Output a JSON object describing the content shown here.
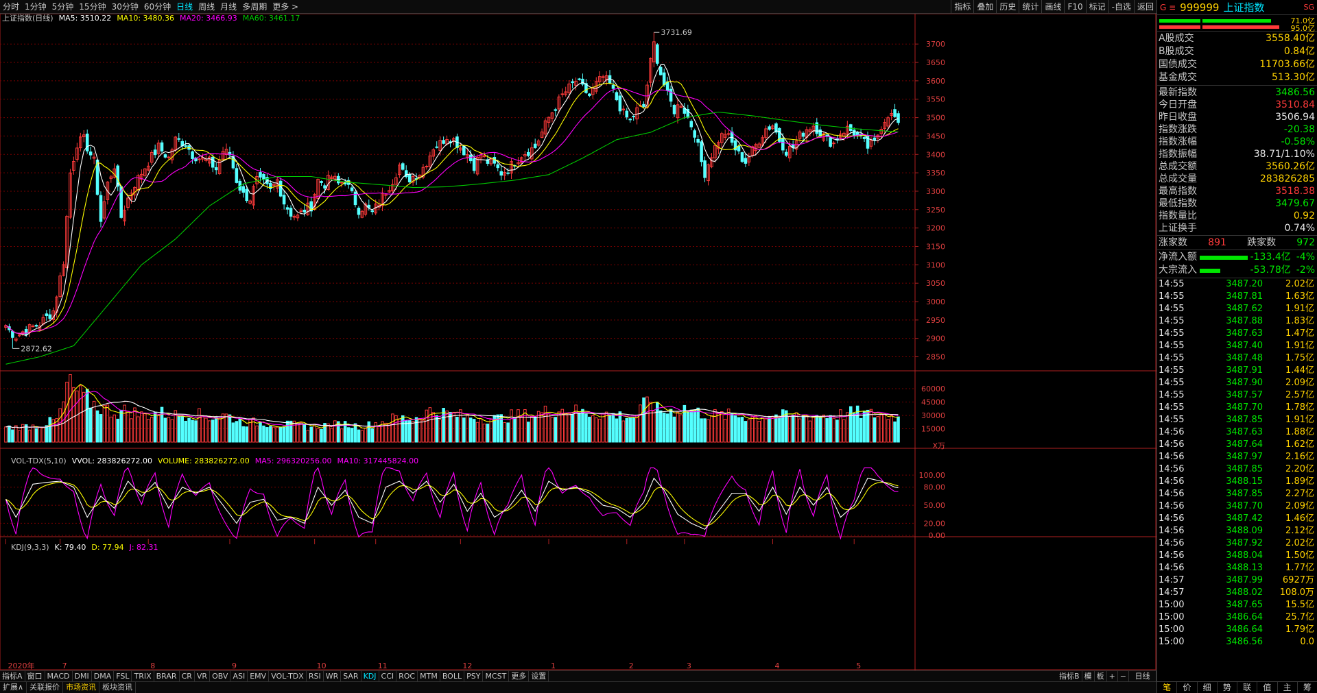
{
  "topbar": {
    "periods": [
      "分时",
      "1分钟",
      "5分钟",
      "15分钟",
      "30分钟",
      "60分钟",
      "日线",
      "周线",
      "月线",
      "多周期",
      "更多 >"
    ],
    "active_period": "日线",
    "tools": [
      "指标",
      "叠加",
      "历史",
      "统计",
      "画线",
      "F10",
      "标记",
      "-自选",
      "返回"
    ]
  },
  "legend_main": {
    "name": "上证指数(日线)",
    "ma5": "MA5: 3510.22",
    "ma10": "MA10: 3480.36",
    "ma20": "MA20: 3466.93",
    "ma60": "MA60: 3461.17"
  },
  "legend_vol": {
    "name": "VOL-TDX(5,10)",
    "vvol": "VVOL: 283826272.00",
    "volume": "VOLUME: 283826272.00",
    "ma5": "MA5: 296320256.00",
    "ma10": "MA10: 317445824.00"
  },
  "legend_kdj": {
    "name": "KDJ(9,3,3)",
    "k": "K: 79.40",
    "d": "D: 77.94",
    "j": "J: 82.31"
  },
  "colors": {
    "up": "#ff3a3a",
    "down": "#54ffff",
    "ma5": "#ffffff",
    "ma10": "#ffff00",
    "ma20": "#ff00ff",
    "ma60": "#00c800",
    "grid": "#7a0000",
    "axis": "#b02020"
  },
  "chart_data": {
    "type": "candlestick",
    "price_ticks": [
      "3700",
      "3650",
      "3600",
      "3550",
      "3500",
      "3450",
      "3400",
      "3350",
      "3300",
      "3250",
      "3200",
      "3150",
      "3100",
      "3050",
      "3000",
      "2950",
      "2900",
      "2850"
    ],
    "price_range": [
      2810,
      3760
    ],
    "vol_ticks": [
      "60000",
      "45000",
      "30000",
      "15000"
    ],
    "vol_unit": "X万",
    "vol_range": [
      0,
      70000
    ],
    "kdj_ticks": [
      "100.00",
      "80.00",
      "50.00",
      "20.00",
      "0.00"
    ],
    "kdj_range": [
      -8,
      115
    ],
    "x_labels": [
      "2020年",
      "7",
      "8",
      "9",
      "10",
      "11",
      "12",
      "1",
      "2",
      "3",
      "4",
      "5"
    ],
    "x_label_index": [
      0,
      16,
      42,
      66,
      91,
      109,
      134,
      160,
      183,
      200,
      226,
      250
    ],
    "max_label": "3731.69",
    "max_index": 191,
    "min_label": "2872.62",
    "min_index": 2,
    "key_closes": [
      [
        0,
        2930
      ],
      [
        3,
        2905
      ],
      [
        5,
        2918
      ],
      [
        10,
        2940
      ],
      [
        14,
        2975
      ],
      [
        17,
        3110
      ],
      [
        19,
        3350
      ],
      [
        21,
        3430
      ],
      [
        23,
        3440
      ],
      [
        26,
        3380
      ],
      [
        28,
        3220
      ],
      [
        30,
        3320
      ],
      [
        32,
        3370
      ],
      [
        34,
        3230
      ],
      [
        36,
        3280
      ],
      [
        38,
        3320
      ],
      [
        40,
        3350
      ],
      [
        42,
        3380
      ],
      [
        45,
        3420
      ],
      [
        48,
        3390
      ],
      [
        50,
        3440
      ],
      [
        53,
        3430
      ],
      [
        55,
        3400
      ],
      [
        57,
        3390
      ],
      [
        60,
        3380
      ],
      [
        62,
        3360
      ],
      [
        64,
        3410
      ],
      [
        66,
        3400
      ],
      [
        68,
        3330
      ],
      [
        70,
        3290
      ],
      [
        72,
        3280
      ],
      [
        74,
        3330
      ],
      [
        76,
        3320
      ],
      [
        78,
        3300
      ],
      [
        80,
        3330
      ],
      [
        82,
        3270
      ],
      [
        84,
        3240
      ],
      [
        86,
        3230
      ],
      [
        88,
        3250
      ],
      [
        90,
        3260
      ],
      [
        92,
        3330
      ],
      [
        94,
        3320
      ],
      [
        96,
        3340
      ],
      [
        98,
        3320
      ],
      [
        100,
        3330
      ],
      [
        102,
        3290
      ],
      [
        104,
        3250
      ],
      [
        106,
        3260
      ],
      [
        108,
        3240
      ],
      [
        110,
        3270
      ],
      [
        112,
        3300
      ],
      [
        114,
        3330
      ],
      [
        116,
        3370
      ],
      [
        118,
        3330
      ],
      [
        120,
        3340
      ],
      [
        122,
        3350
      ],
      [
        124,
        3380
      ],
      [
        126,
        3420
      ],
      [
        128,
        3430
      ],
      [
        130,
        3450
      ],
      [
        132,
        3440
      ],
      [
        134,
        3420
      ],
      [
        136,
        3400
      ],
      [
        138,
        3370
      ],
      [
        140,
        3400
      ],
      [
        142,
        3380
      ],
      [
        144,
        3370
      ],
      [
        146,
        3350
      ],
      [
        148,
        3360
      ],
      [
        150,
        3380
      ],
      [
        152,
        3400
      ],
      [
        154,
        3410
      ],
      [
        156,
        3420
      ],
      [
        158,
        3460
      ],
      [
        160,
        3500
      ],
      [
        162,
        3530
      ],
      [
        164,
        3560
      ],
      [
        166,
        3580
      ],
      [
        168,
        3600
      ],
      [
        170,
        3580
      ],
      [
        172,
        3560
      ],
      [
        174,
        3590
      ],
      [
        176,
        3610
      ],
      [
        178,
        3590
      ],
      [
        180,
        3550
      ],
      [
        182,
        3510
      ],
      [
        184,
        3490
      ],
      [
        186,
        3520
      ],
      [
        188,
        3530
      ],
      [
        190,
        3650
      ],
      [
        191,
        3700
      ],
      [
        193,
        3620
      ],
      [
        195,
        3560
      ],
      [
        197,
        3520
      ],
      [
        199,
        3540
      ],
      [
        201,
        3500
      ],
      [
        203,
        3460
      ],
      [
        205,
        3380
      ],
      [
        206,
        3350
      ],
      [
        208,
        3400
      ],
      [
        210,
        3440
      ],
      [
        212,
        3460
      ],
      [
        214,
        3430
      ],
      [
        216,
        3400
      ],
      [
        218,
        3380
      ],
      [
        220,
        3410
      ],
      [
        222,
        3440
      ],
      [
        224,
        3470
      ],
      [
        226,
        3480
      ],
      [
        228,
        3440
      ],
      [
        230,
        3410
      ],
      [
        232,
        3420
      ],
      [
        234,
        3450
      ],
      [
        236,
        3470
      ],
      [
        238,
        3480
      ],
      [
        240,
        3460
      ],
      [
        242,
        3440
      ],
      [
        244,
        3430
      ],
      [
        246,
        3460
      ],
      [
        248,
        3470
      ],
      [
        250,
        3460
      ],
      [
        252,
        3440
      ],
      [
        254,
        3420
      ],
      [
        256,
        3430
      ],
      [
        258,
        3480
      ],
      [
        260,
        3510
      ],
      [
        262,
        3500
      ],
      [
        263,
        3486
      ]
    ],
    "vol_series": [
      [
        0,
        16000
      ],
      [
        4,
        17000
      ],
      [
        8,
        18000
      ],
      [
        12,
        21000
      ],
      [
        15,
        25000
      ],
      [
        17,
        42000
      ],
      [
        18,
        65000
      ],
      [
        20,
        60000
      ],
      [
        22,
        52000
      ],
      [
        24,
        48000
      ],
      [
        27,
        40000
      ],
      [
        30,
        36000
      ],
      [
        33,
        33000
      ],
      [
        36,
        36000
      ],
      [
        40,
        30000
      ],
      [
        45,
        33000
      ],
      [
        50,
        30000
      ],
      [
        55,
        32000
      ],
      [
        60,
        28000
      ],
      [
        65,
        30000
      ],
      [
        70,
        22000
      ],
      [
        75,
        22000
      ],
      [
        80,
        20000
      ],
      [
        85,
        19000
      ],
      [
        90,
        17000
      ],
      [
        95,
        19000
      ],
      [
        100,
        20000
      ],
      [
        105,
        17000
      ],
      [
        110,
        22000
      ],
      [
        115,
        27000
      ],
      [
        120,
        26000
      ],
      [
        125,
        35000
      ],
      [
        130,
        32000
      ],
      [
        135,
        29000
      ],
      [
        140,
        27000
      ],
      [
        145,
        26000
      ],
      [
        150,
        30000
      ],
      [
        155,
        30000
      ],
      [
        160,
        35000
      ],
      [
        165,
        37000
      ],
      [
        170,
        33000
      ],
      [
        175,
        32000
      ],
      [
        180,
        30000
      ],
      [
        185,
        28000
      ],
      [
        190,
        48000
      ],
      [
        192,
        36000
      ],
      [
        195,
        34000
      ],
      [
        200,
        38000
      ],
      [
        205,
        32000
      ],
      [
        210,
        30000
      ],
      [
        215,
        30000
      ],
      [
        220,
        28000
      ],
      [
        225,
        30000
      ],
      [
        230,
        29000
      ],
      [
        235,
        29000
      ],
      [
        240,
        30000
      ],
      [
        245,
        30000
      ],
      [
        250,
        33000
      ],
      [
        255,
        31000
      ],
      [
        260,
        30000
      ],
      [
        263,
        28000
      ]
    ],
    "kdj_k_keys": [
      [
        0,
        60
      ],
      [
        3,
        30
      ],
      [
        8,
        85
      ],
      [
        12,
        88
      ],
      [
        16,
        90
      ],
      [
        20,
        80
      ],
      [
        24,
        30
      ],
      [
        28,
        65
      ],
      [
        32,
        45
      ],
      [
        36,
        90
      ],
      [
        40,
        65
      ],
      [
        44,
        88
      ],
      [
        48,
        45
      ],
      [
        52,
        80
      ],
      [
        56,
        70
      ],
      [
        60,
        80
      ],
      [
        64,
        50
      ],
      [
        68,
        20
      ],
      [
        72,
        55
      ],
      [
        76,
        60
      ],
      [
        80,
        25
      ],
      [
        84,
        30
      ],
      [
        88,
        20
      ],
      [
        92,
        80
      ],
      [
        96,
        50
      ],
      [
        100,
        75
      ],
      [
        104,
        30
      ],
      [
        108,
        20
      ],
      [
        112,
        80
      ],
      [
        116,
        90
      ],
      [
        120,
        70
      ],
      [
        124,
        90
      ],
      [
        128,
        55
      ],
      [
        132,
        85
      ],
      [
        136,
        40
      ],
      [
        140,
        70
      ],
      [
        144,
        30
      ],
      [
        148,
        45
      ],
      [
        152,
        75
      ],
      [
        156,
        40
      ],
      [
        160,
        90
      ],
      [
        164,
        75
      ],
      [
        168,
        80
      ],
      [
        172,
        70
      ],
      [
        176,
        50
      ],
      [
        180,
        45
      ],
      [
        184,
        30
      ],
      [
        188,
        55
      ],
      [
        191,
        95
      ],
      [
        194,
        75
      ],
      [
        198,
        35
      ],
      [
        202,
        20
      ],
      [
        206,
        10
      ],
      [
        210,
        40
      ],
      [
        214,
        70
      ],
      [
        218,
        70
      ],
      [
        222,
        40
      ],
      [
        226,
        80
      ],
      [
        230,
        35
      ],
      [
        234,
        80
      ],
      [
        238,
        50
      ],
      [
        242,
        80
      ],
      [
        246,
        30
      ],
      [
        250,
        50
      ],
      [
        254,
        95
      ],
      [
        258,
        90
      ],
      [
        262,
        80
      ],
      [
        263,
        79
      ]
    ],
    "ma60_keys": [
      [
        0,
        2830
      ],
      [
        10,
        2850
      ],
      [
        20,
        2880
      ],
      [
        30,
        2990
      ],
      [
        40,
        3100
      ],
      [
        50,
        3170
      ],
      [
        60,
        3260
      ],
      [
        70,
        3320
      ],
      [
        80,
        3340
      ],
      [
        90,
        3340
      ],
      [
        100,
        3325
      ],
      [
        110,
        3318
      ],
      [
        120,
        3310
      ],
      [
        130,
        3312
      ],
      [
        140,
        3320
      ],
      [
        150,
        3330
      ],
      [
        160,
        3345
      ],
      [
        170,
        3390
      ],
      [
        180,
        3440
      ],
      [
        190,
        3460
      ],
      [
        200,
        3500
      ],
      [
        210,
        3515
      ],
      [
        220,
        3505
      ],
      [
        230,
        3492
      ],
      [
        240,
        3480
      ],
      [
        250,
        3470
      ],
      [
        263,
        3461
      ]
    ]
  },
  "right_panel": {
    "header": {
      "code": "999999",
      "name": "上证指数",
      "flag": "SG",
      "prefix": "G ≡"
    },
    "bars": {
      "top_val": "71.0亿",
      "bot_val": "95.0亿"
    },
    "turnover": [
      {
        "label": "A股成交",
        "value": "3558.40亿",
        "color": "#ffd200"
      },
      {
        "label": "B股成交",
        "value": "0.84亿",
        "color": "#ffd200"
      },
      {
        "label": "国债成交",
        "value": "11703.66亿",
        "color": "#ffd200"
      },
      {
        "label": "基金成交",
        "value": "513.30亿",
        "color": "#ffd200"
      }
    ],
    "stats": [
      {
        "label": "最新指数",
        "value": "3486.56",
        "color": "#00e600"
      },
      {
        "label": "今日开盘",
        "value": "3510.84",
        "color": "#ff3a3a"
      },
      {
        "label": "昨日收盘",
        "value": "3506.94",
        "color": "#e6e6e6"
      },
      {
        "label": "指数涨跌",
        "value": "-20.38",
        "color": "#00e600"
      },
      {
        "label": "指数涨幅",
        "value": "-0.58%",
        "color": "#00e600"
      },
      {
        "label": "指数振幅",
        "value": "38.71/1.10%",
        "color": "#e6e6e6"
      },
      {
        "label": "总成交额",
        "value": "3560.26亿",
        "color": "#ffd200"
      },
      {
        "label": "总成交量",
        "value": "283826285",
        "color": "#ffd200"
      },
      {
        "label": "最高指数",
        "value": "3518.38",
        "color": "#ff3a3a"
      },
      {
        "label": "最低指数",
        "value": "3479.67",
        "color": "#00e600"
      },
      {
        "label": "指数量比",
        "value": "0.92",
        "color": "#ffd200"
      },
      {
        "label": "上证换手",
        "value": "0.74%",
        "color": "#e6e6e6"
      }
    ],
    "breadth": {
      "up_label": "涨家数",
      "up": "891",
      "down_label": "跌家数",
      "down": "972"
    },
    "flows": [
      {
        "label": "净流入额",
        "value": "-133.4亿",
        "pct": "-4%"
      },
      {
        "label": "大宗流入",
        "value": "-53.78亿",
        "pct": "-2%"
      }
    ],
    "ticks": [
      [
        "14:55",
        "3487.20",
        "2.02亿"
      ],
      [
        "14:55",
        "3487.81",
        "1.63亿"
      ],
      [
        "14:55",
        "3487.62",
        "1.91亿"
      ],
      [
        "14:55",
        "3487.88",
        "1.83亿"
      ],
      [
        "14:55",
        "3487.63",
        "1.47亿"
      ],
      [
        "14:55",
        "3487.40",
        "1.91亿"
      ],
      [
        "14:55",
        "3487.48",
        "1.75亿"
      ],
      [
        "14:55",
        "3487.91",
        "1.44亿"
      ],
      [
        "14:55",
        "3487.90",
        "2.09亿"
      ],
      [
        "14:55",
        "3487.57",
        "2.57亿"
      ],
      [
        "14:55",
        "3487.70",
        "1.78亿"
      ],
      [
        "14:55",
        "3487.85",
        "1.91亿"
      ],
      [
        "14:56",
        "3487.63",
        "1.88亿"
      ],
      [
        "14:56",
        "3487.64",
        "1.62亿"
      ],
      [
        "14:56",
        "3487.97",
        "2.16亿"
      ],
      [
        "14:56",
        "3487.85",
        "2.20亿"
      ],
      [
        "14:56",
        "3488.15",
        "1.89亿"
      ],
      [
        "14:56",
        "3487.85",
        "2.27亿"
      ],
      [
        "14:56",
        "3487.70",
        "2.09亿"
      ],
      [
        "14:56",
        "3487.42",
        "1.46亿"
      ],
      [
        "14:56",
        "3488.09",
        "2.12亿"
      ],
      [
        "14:56",
        "3487.92",
        "2.02亿"
      ],
      [
        "14:56",
        "3488.04",
        "1.50亿"
      ],
      [
        "14:56",
        "3488.13",
        "1.77亿"
      ],
      [
        "14:57",
        "3487.99",
        "6927万"
      ],
      [
        "14:57",
        "3488.02",
        "108.0万"
      ],
      [
        "15:00",
        "3487.65",
        "15.5亿"
      ],
      [
        "15:00",
        "3486.64",
        "25.7亿"
      ],
      [
        "15:00",
        "3486.64",
        "1.79亿"
      ],
      [
        "15:00",
        "3486.56",
        "0.0"
      ]
    ],
    "bottom_tabs": [
      "笔",
      "价",
      "细",
      "势",
      "联",
      "值",
      "主",
      "筹"
    ]
  },
  "tabs1": {
    "items": [
      "指标A",
      "窗口",
      "MACD",
      "DMI",
      "DMA",
      "FSL",
      "TRIX",
      "BRAR",
      "CR",
      "VR",
      "OBV",
      "ASI",
      "EMV",
      "VOL-TDX",
      "RSI",
      "WR",
      "SAR",
      "KDJ",
      "CCI",
      "ROC",
      "MTM",
      "BOLL",
      "PSY",
      "MCST",
      "更多",
      "设置"
    ],
    "active": "KDJ",
    "right": [
      "指标B",
      "模",
      "板",
      "+",
      "−"
    ],
    "period": "日线"
  },
  "tabs2": {
    "items": [
      "扩展∧",
      "关联报价",
      "市场资讯",
      "板块资讯"
    ]
  }
}
